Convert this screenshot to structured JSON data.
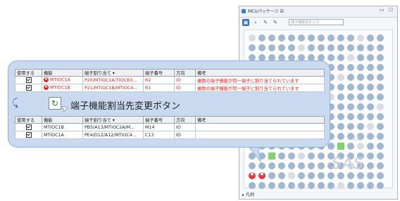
{
  "panel": {
    "tab_title": "MCUパッケージ ☒",
    "window_buttons": "▭ ☐",
    "search_placeholder": "端子機能名を入力",
    "footer_label": "▸ 凡例",
    "logo_text": "SAS",
    "logo_sub": "-LC"
  },
  "callout": {
    "table_headers": [
      "使用する",
      "機能",
      "端子割り当て ▾",
      "端子番号",
      "方向",
      "備考"
    ],
    "top_rows": [
      {
        "function": "MTIOC1A",
        "assignment": "P20/MTIOC1A/TIOCB3...",
        "pin": "R2",
        "direction": "IO",
        "remark": "複数の端子機能が同一端子に割り当てられています",
        "error": true
      },
      {
        "function": "MTIOC1B",
        "assignment": "P21/MTIOC1B/MTIOC4...",
        "pin": "R1",
        "direction": "IO",
        "remark": "複数の端子機能が同一端子に割り当てられています",
        "error": true
      }
    ],
    "bottom_rows": [
      {
        "function": "MTIOC1B",
        "assignment": "PB5/A13/MTIOC2A/M...",
        "pin": "M14",
        "direction": "IO",
        "remark": "",
        "error": false
      },
      {
        "function": "MTIOC1A",
        "assignment": "PE4/D12/A12/MTIOC4...",
        "pin": "C13",
        "direction": "IO",
        "remark": "",
        "error": false
      }
    ],
    "swap_caption": "端子機能割当先変更ボタン"
  }
}
